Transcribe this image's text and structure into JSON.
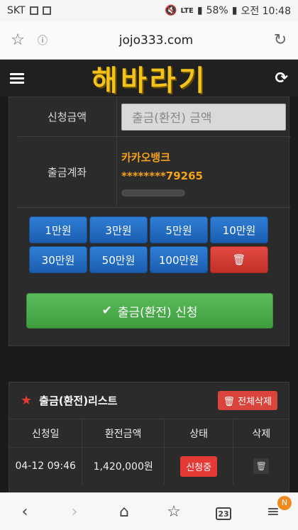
{
  "status_bar": {
    "carrier": "SKT",
    "battery": "58%",
    "time": "오전 10:48",
    "network": "LTE"
  },
  "browser": {
    "url": "jojo333.com",
    "tabs_count": "23",
    "notification_badge": "N"
  },
  "header": {
    "logo": "해바라기"
  },
  "form": {
    "amount_label": "신청금액",
    "amount_placeholder": "출금(환전) 금액",
    "account_label": "출금계좌",
    "bank": "카카오뱅크",
    "account_number": "********79265",
    "amount_buttons": [
      "1만원",
      "3만원",
      "5만원",
      "10만원",
      "30만원",
      "50만원",
      "100만원"
    ],
    "submit_label": "출금(환전) 신청"
  },
  "list": {
    "title": "출금(환전)리스트",
    "delete_all_label": "전체삭제",
    "columns": [
      "신청일",
      "환전금액",
      "상태",
      "삭제"
    ],
    "rows": [
      {
        "date": "04-12 09:46",
        "amount": "1,420,000원",
        "status": "신청중"
      }
    ]
  },
  "colors": {
    "accent_gold": "#f3c21b",
    "button_blue": "#2f7fd6",
    "button_green": "#5cbc5c",
    "danger_red": "#e53935"
  }
}
